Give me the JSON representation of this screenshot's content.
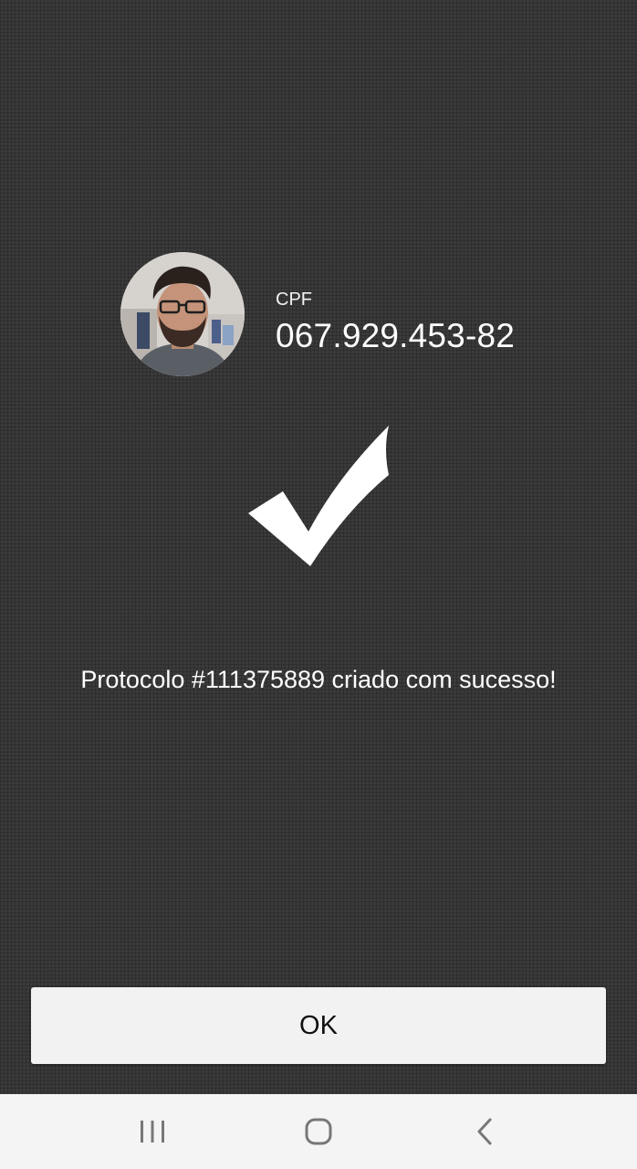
{
  "user": {
    "avatar_alt": "foto do usuário",
    "cpf_label": "CPF",
    "cpf_value": "067.929.453-82"
  },
  "status": {
    "icon": "checkmark-icon",
    "message": "Protocolo #111375889 criado com sucesso!"
  },
  "actions": {
    "ok_label": "OK"
  },
  "navigation_bar": {
    "items": [
      {
        "icon": "recent-apps-icon"
      },
      {
        "icon": "home-icon"
      },
      {
        "icon": "back-icon"
      }
    ]
  },
  "colors": {
    "background": "#3a3a3a",
    "text": "#ffffff",
    "button_bg": "#f2f2f2",
    "navbar_bg": "#f4f4f4",
    "nav_icon": "#777777"
  }
}
